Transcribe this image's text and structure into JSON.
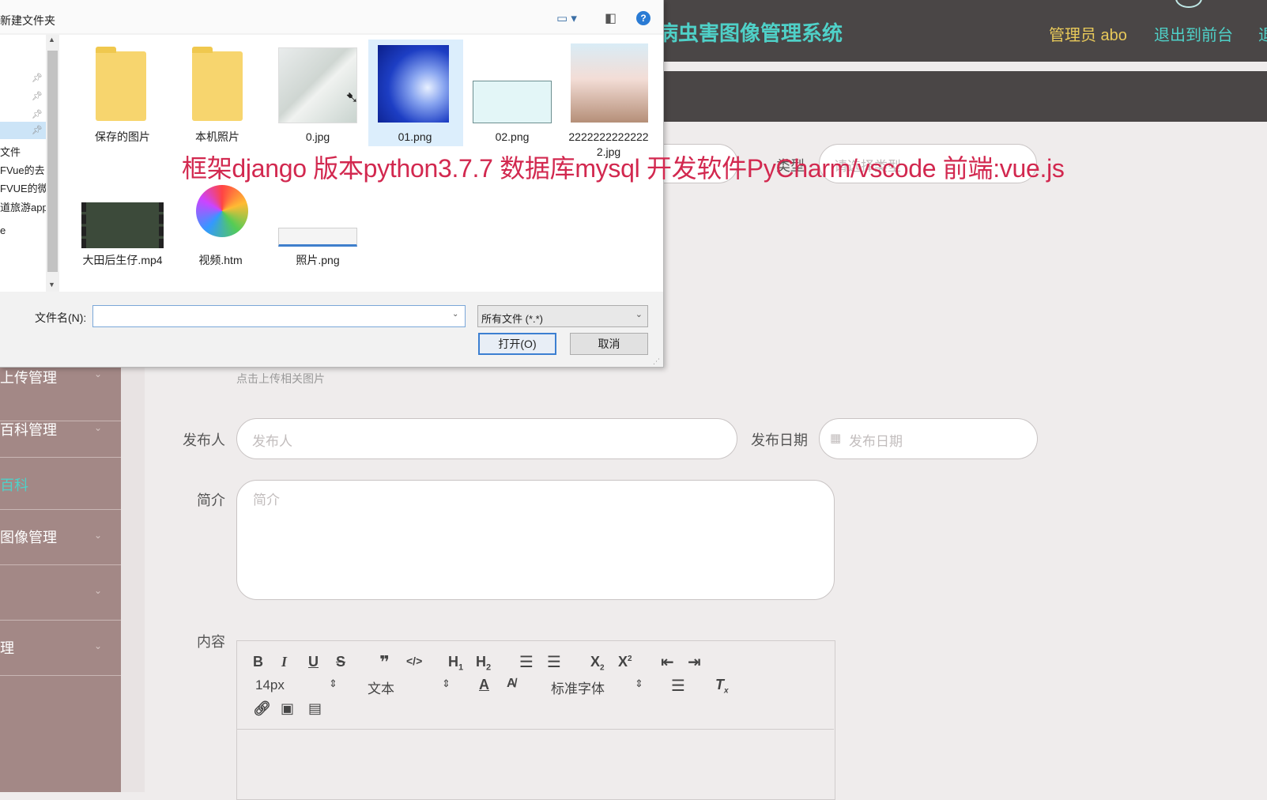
{
  "header": {
    "title_visible": "病虫害图像管理系统",
    "admin": "管理员 abo",
    "exit_front": "退出到前台",
    "exit_cut": "退"
  },
  "sidebar": {
    "items": [
      {
        "label": "上传管理"
      },
      {
        "label": "百科管理"
      },
      {
        "label": "百科"
      },
      {
        "label": "图像管理"
      },
      {
        "label": ""
      },
      {
        "label": "理"
      }
    ]
  },
  "form": {
    "upload_hint": "点击上传相关图片",
    "publisher_label": "发布人",
    "publisher_placeholder": "发布人",
    "date_label": "发布日期",
    "date_placeholder": "发布日期",
    "intro_label": "简介",
    "intro_placeholder": "简介",
    "content_label": "内容",
    "type_label": "类型",
    "type_placeholder": "请选择类型"
  },
  "editor": {
    "font_size": "14px",
    "heading": "文本",
    "font_family": "标准字体"
  },
  "dialog": {
    "title": "新建文件夹",
    "nav_items": [
      "文件",
      "FVue的去",
      "FVUE的微",
      "道旅游app",
      "e"
    ],
    "files": [
      {
        "name": "保存的图片"
      },
      {
        "name": "本机照片"
      },
      {
        "name": "0.jpg"
      },
      {
        "name": "01.png"
      },
      {
        "name": "02.png"
      },
      {
        "name": "22222222222222.jpg"
      },
      {
        "name": "大田后生仔.mp4"
      },
      {
        "name": "视频.htm"
      },
      {
        "name": "照片.png"
      }
    ],
    "filename_label": "文件名(N):",
    "filename_value": "",
    "filetype": "所有文件 (*.*)",
    "open_button": "打开(O)",
    "cancel_button": "取消"
  },
  "overlay_text": "框架django 版本python3.7.7 数据库mysql 开发软件PyCharm/vscode 前端:vue.js"
}
